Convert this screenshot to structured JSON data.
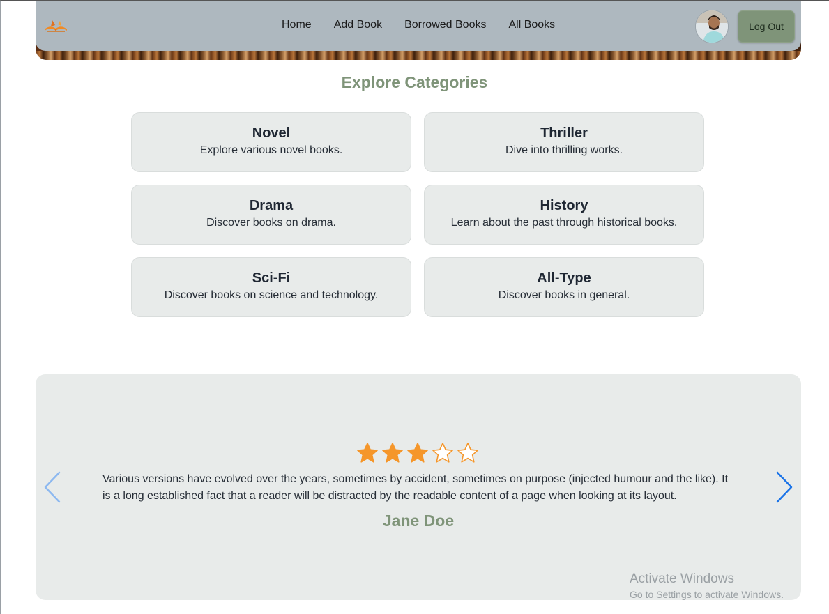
{
  "nav": {
    "links": [
      "Home",
      "Add Book",
      "Borrowed Books",
      "All Books"
    ],
    "logout_label": "Log Out"
  },
  "categories": {
    "title": "Explore Categories",
    "items": [
      {
        "title": "Novel",
        "desc": "Explore various novel books."
      },
      {
        "title": "Thriller",
        "desc": "Dive into thrilling works."
      },
      {
        "title": "Drama",
        "desc": "Discover books on drama."
      },
      {
        "title": "History",
        "desc": "Learn about the past through historical books."
      },
      {
        "title": "Sci-Fi",
        "desc": "Discover books on science and technology."
      },
      {
        "title": "All-Type",
        "desc": "Discover books in general."
      }
    ]
  },
  "testimonial": {
    "rating": 3,
    "rating_max": 5,
    "text": "Various versions have evolved over the years, sometimes by accident, sometimes on purpose (injected humour and the like). It is a long established fact that a reader will be distracted by the readable content of a page when looking at its layout.",
    "name": "Jane Doe"
  },
  "watermark": {
    "title": "Activate Windows",
    "subtitle": "Go to Settings to activate Windows."
  },
  "colors": {
    "accent": "#7f9479",
    "navbar": "#aeb8bf",
    "card": "#e8ebea",
    "star": "#f5962a",
    "arrow_active": "#1a73e8"
  },
  "icons": [
    "book-logo-icon",
    "star-icon",
    "chevron-left-icon",
    "chevron-right-icon"
  ]
}
